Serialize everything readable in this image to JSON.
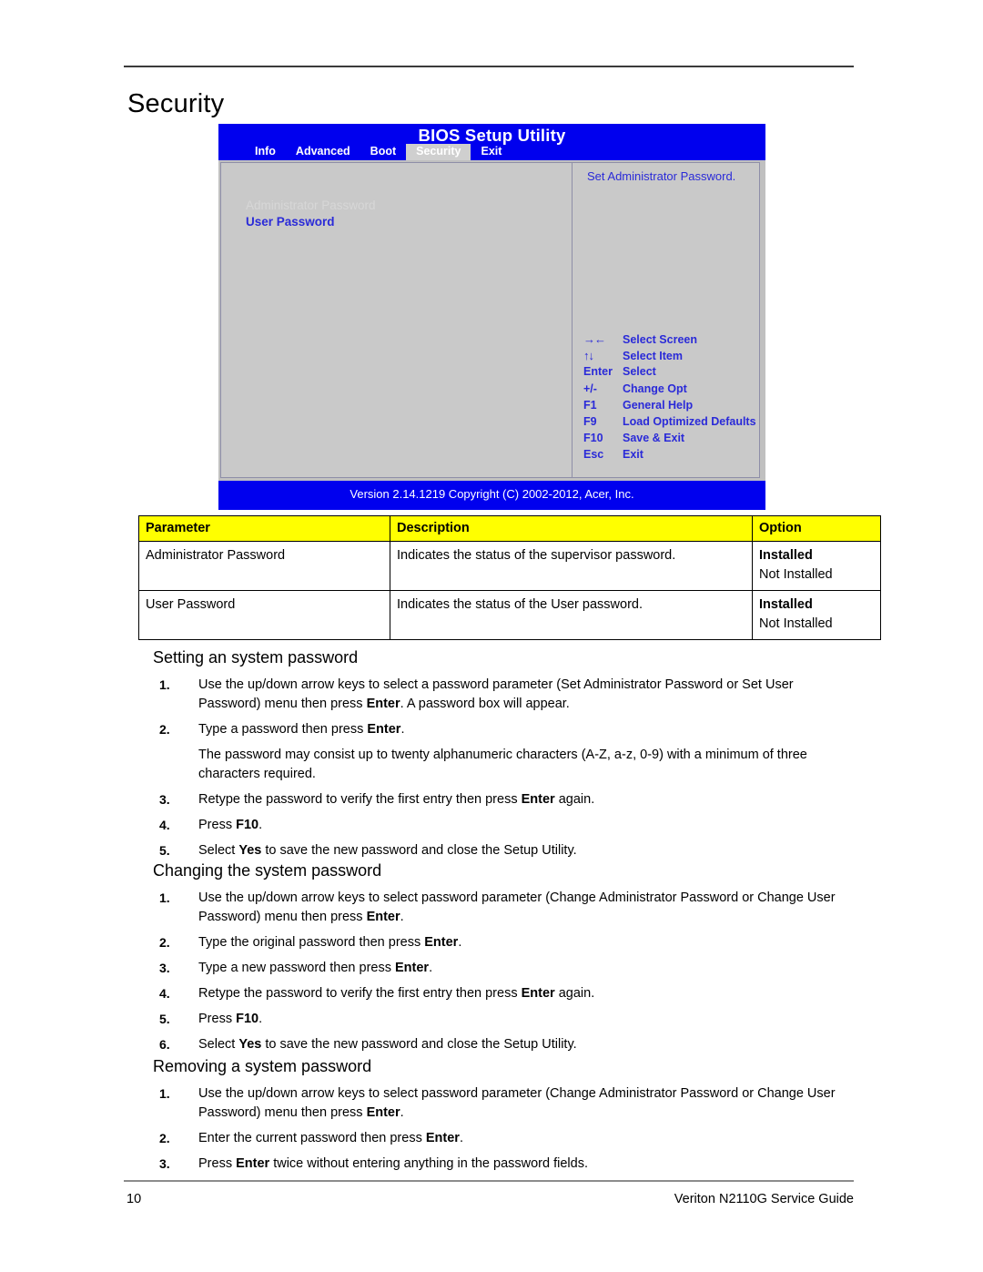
{
  "page": {
    "title": "Security",
    "footer_page_number": "10",
    "footer_guide_title": "Veriton N2110G Service Guide"
  },
  "bios": {
    "title": "BIOS Setup Utility",
    "tabs": [
      {
        "label": "Info",
        "active": false
      },
      {
        "label": "Advanced",
        "active": false
      },
      {
        "label": "Boot",
        "active": false
      },
      {
        "label": "Security",
        "active": true
      },
      {
        "label": "Exit",
        "active": false
      }
    ],
    "items": [
      {
        "label": "Administrator Password",
        "state": "disabled"
      },
      {
        "label": "User Password",
        "state": "enabled"
      }
    ],
    "help_text": "Set Administrator Password.",
    "keys": [
      {
        "key": "→←",
        "action": "Select Screen",
        "symbol": true
      },
      {
        "key": "↑↓",
        "action": "Select Item",
        "symbol": true
      },
      {
        "key": "Enter",
        "action": "Select",
        "symbol": false
      },
      {
        "key": "+/-",
        "action": "Change Opt",
        "symbol": false
      },
      {
        "key": "F1",
        "action": "General Help",
        "symbol": false
      },
      {
        "key": "F9",
        "action": "Load Optimized Defaults",
        "symbol": false
      },
      {
        "key": "F10",
        "action": "Save & Exit",
        "symbol": false
      },
      {
        "key": "Esc",
        "action": "Exit",
        "symbol": false
      }
    ],
    "version": "Version 2.14.1219 Copyright (C) 2002-2012, Acer, Inc.",
    "colors": {
      "title_bar": "#0000ee",
      "panel": "#c9c9c9",
      "text_blue": "#2a2ad8",
      "text_disabled": "#d7d7d7"
    }
  },
  "table": {
    "headers": [
      "Parameter",
      "Description",
      "Option"
    ],
    "header_background": "#ffff00",
    "rows": [
      {
        "parameter": "Administrator Password",
        "description": "Indicates the status of the supervisor password.",
        "option_bold": "Installed",
        "option_normal": "Not Installed"
      },
      {
        "parameter": "User Password",
        "description": "Indicates the status of the User password.",
        "option_bold": "Installed",
        "option_normal": "Not Installed"
      }
    ]
  },
  "sections": [
    {
      "heading": "Setting an system password",
      "steps": [
        {
          "num": "1.",
          "html": "Use the up/down arrow keys to select a password parameter (Set Administrator Password or Set User Password) menu then press <b>Enter</b>. A password box will appear."
        },
        {
          "num": "2.",
          "html": "Type a password then press <b>Enter</b>."
        },
        {
          "num": "",
          "html": "The password may consist up to twenty alphanumeric characters (A-Z, a-z, 0-9) with a minimum of three characters required."
        },
        {
          "num": "3.",
          "html": "Retype the password to verify the first entry then press <b>Enter</b> again."
        },
        {
          "num": "4.",
          "html": "Press <b>F10</b>."
        },
        {
          "num": "5.",
          "html": "Select <b>Yes</b> to save the new password and close the Setup Utility."
        }
      ]
    },
    {
      "heading": "Changing the system password",
      "steps": [
        {
          "num": "1.",
          "html": "Use the up/down arrow keys to select password parameter (Change Administrator Password or Change User Password) menu then press <b>Enter</b>."
        },
        {
          "num": "2.",
          "html": "Type the original password then press <b>Enter</b>."
        },
        {
          "num": "3.",
          "html": "Type a new password then press <b>Enter</b>."
        },
        {
          "num": "4.",
          "html": "Retype the password to verify the first entry then press <b>Enter</b> again."
        },
        {
          "num": "5.",
          "html": "Press <b>F10</b>."
        },
        {
          "num": "6.",
          "html": "Select <b>Yes</b> to save the new password and close the Setup Utility."
        }
      ]
    },
    {
      "heading": "Removing a system password",
      "steps": [
        {
          "num": "1.",
          "html": "Use the up/down arrow keys to select password parameter (Change Administrator Password or Change User Password) menu then press <b>Enter</b>."
        },
        {
          "num": "2.",
          "html": "Enter the current password then press <b>Enter</b>."
        },
        {
          "num": "3.",
          "html": "Press <b>Enter</b> twice without entering anything in the password fields."
        }
      ]
    }
  ]
}
